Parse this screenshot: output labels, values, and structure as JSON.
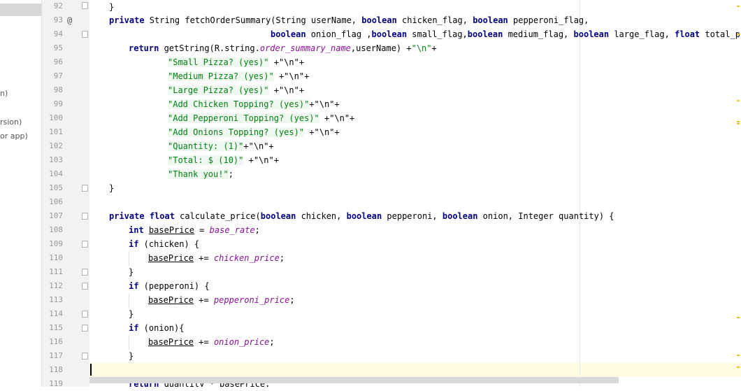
{
  "sidebar_fragments": [
    "n)",
    "rsion)",
    "or app)"
  ],
  "line_numbers": [
    "92",
    "93",
    "94",
    "95",
    "96",
    "97",
    "98",
    "99",
    "100",
    "101",
    "102",
    "103",
    "104",
    "105",
    "106",
    "107",
    "108",
    "109",
    "110",
    "111",
    "112",
    "113",
    "114",
    "115",
    "116",
    "117",
    "118",
    "119"
  ],
  "override_marker": "@",
  "code": {
    "l92": "}",
    "l93_a": "private",
    "l93_b": " String fetchOrderSummary(String userName, ",
    "l93_c": "boolean",
    "l93_d": " chicken_flag, ",
    "l93_e": "boolean",
    "l93_f": " pepperoni_flag,",
    "l94_a": "boolean",
    "l94_b": " onion_flag ,",
    "l94_c": "boolean",
    "l94_d": " small_flag,",
    "l94_e": "boolean",
    "l94_f": " medium_flag, ",
    "l94_g": "boolean",
    "l94_h": " large_flag, ",
    "l94_i": "float",
    "l94_j": " total_pric",
    "l95_a": "return",
    "l95_b": " getString(R.string.",
    "l95_c": "order_summary_name",
    "l95_d": ",userName) +",
    "l95_e": "\"\\n\"",
    "l95_f": "+",
    "strings": [
      {
        "s": "\"Small Pizza? (yes)\"",
        "t": " +\"\\n\"+"
      },
      {
        "s": "\"Medium Pizza? (yes)\"",
        "t": " +\"\\n\"+"
      },
      {
        "s": "\"Large Pizza? (yes)\"",
        "t": " +\"\\n\"+"
      },
      {
        "s": "\"Add Chicken Topping? (yes)\"",
        "t": "+\"\\n\"+"
      },
      {
        "s": "\"Add Pepperoni Topping? (yes)\"",
        "t": " +\"\\n\"+"
      },
      {
        "s": "\"Add Onions Topping? (yes)\"",
        "t": " +\"\\n\"+"
      },
      {
        "s": "\"Quantity: (1)\"",
        "t": "+\"\\n\"+"
      },
      {
        "s": "\"Total: $ (10)\"",
        "t": " +\"\\n\"+"
      },
      {
        "s": "\"Thank you!\"",
        "t": ";"
      }
    ],
    "l105": "}",
    "l107_a": "private",
    "l107_b": " ",
    "l107_c": "float",
    "l107_d": " calculate_price(",
    "l107_e": "boolean",
    "l107_f": " chicken, ",
    "l107_g": "boolean",
    "l107_h": " pepperoni, ",
    "l107_i": "boolean",
    "l107_j": " onion, Integer quantity) {",
    "l108_a": "int",
    "l108_b": "basePrice",
    "l108_c": " = ",
    "l108_d": "base_rate",
    "l108_e": ";",
    "l109_a": "if",
    "l109_b": " (chicken) {",
    "l110_a": "basePrice",
    "l110_b": " += ",
    "l110_c": "chicken_price",
    "l110_d": ";",
    "l111": "}",
    "l112_a": "if",
    "l112_b": " (pepperoni) {",
    "l113_a": "basePrice",
    "l113_b": " += ",
    "l113_c": "pepperoni_price",
    "l113_d": ";",
    "l114": "}",
    "l115_a": "if",
    "l115_b": " (onion){",
    "l116_a": "basePrice",
    "l116_b": " += ",
    "l116_c": "onion_price",
    "l116_d": ";",
    "l117": "}",
    "l119_a": "return",
    "l119_b": " quantity * basePrice;"
  }
}
